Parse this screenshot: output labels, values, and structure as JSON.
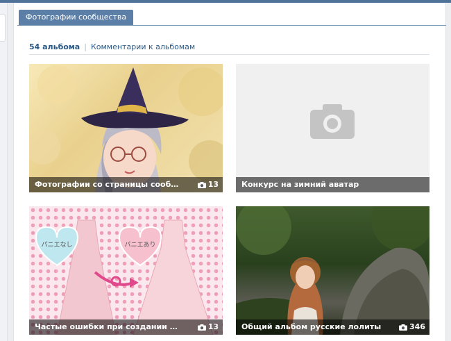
{
  "tab": {
    "label": "Фотографии сообщества"
  },
  "subnav": {
    "count": "54 альбома",
    "comments": "Комментарии к альбомам"
  },
  "albums": [
    {
      "title": "Фотографии со страницы сообще...",
      "count": "13"
    },
    {
      "title": "Конкурс на зимний аватар",
      "count": ""
    },
    {
      "title": "Частые ошибки при создании обр...",
      "count": "13"
    },
    {
      "title": "Общий альбом русские лолиты",
      "count": "346"
    }
  ],
  "album3_art": {
    "left_heart": "パニエなし",
    "right_heart": "パニエあり"
  },
  "colors": {
    "accent": "#507299",
    "link": "#2a5885",
    "tab": "#5b7fa6"
  }
}
